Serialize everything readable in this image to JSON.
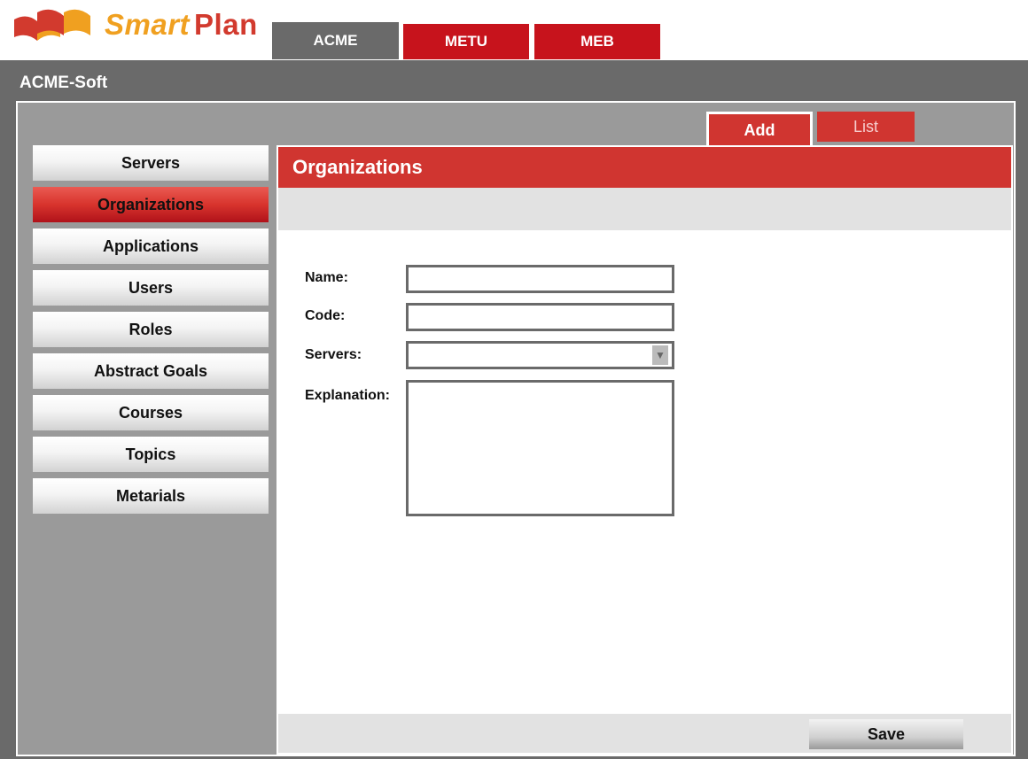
{
  "logo": {
    "smart": "Smart",
    "plan": "Plan"
  },
  "top_tabs": [
    {
      "label": "ACME",
      "active": true
    },
    {
      "label": "METU",
      "active": false
    },
    {
      "label": "MEB",
      "active": false
    }
  ],
  "window_title": "ACME-Soft",
  "sub_tabs": {
    "add": "Add",
    "list": "List"
  },
  "sidebar": {
    "items": [
      {
        "label": "Servers"
      },
      {
        "label": "Organizations",
        "active": true
      },
      {
        "label": "Applications"
      },
      {
        "label": "Users"
      },
      {
        "label": "Roles"
      },
      {
        "label": "Abstract Goals"
      },
      {
        "label": "Courses"
      },
      {
        "label": "Topics"
      },
      {
        "label": "Metarials"
      }
    ]
  },
  "panel": {
    "title": "Organizations",
    "form": {
      "name_label": "Name:",
      "name_value": "",
      "code_label": "Code:",
      "code_value": "",
      "servers_label": "Servers:",
      "servers_value": "",
      "explanation_label": "Explanation:",
      "explanation_value": ""
    },
    "save_label": "Save"
  },
  "colors": {
    "brand_red": "#d03530",
    "tab_red": "#c7131c",
    "frame_gray": "#6a6a6a",
    "inner_gray": "#9a9a9a",
    "logo_orange": "#f0a020"
  },
  "icons": {
    "logo": "open-book-icon",
    "dropdown": "triangle-down-icon"
  }
}
